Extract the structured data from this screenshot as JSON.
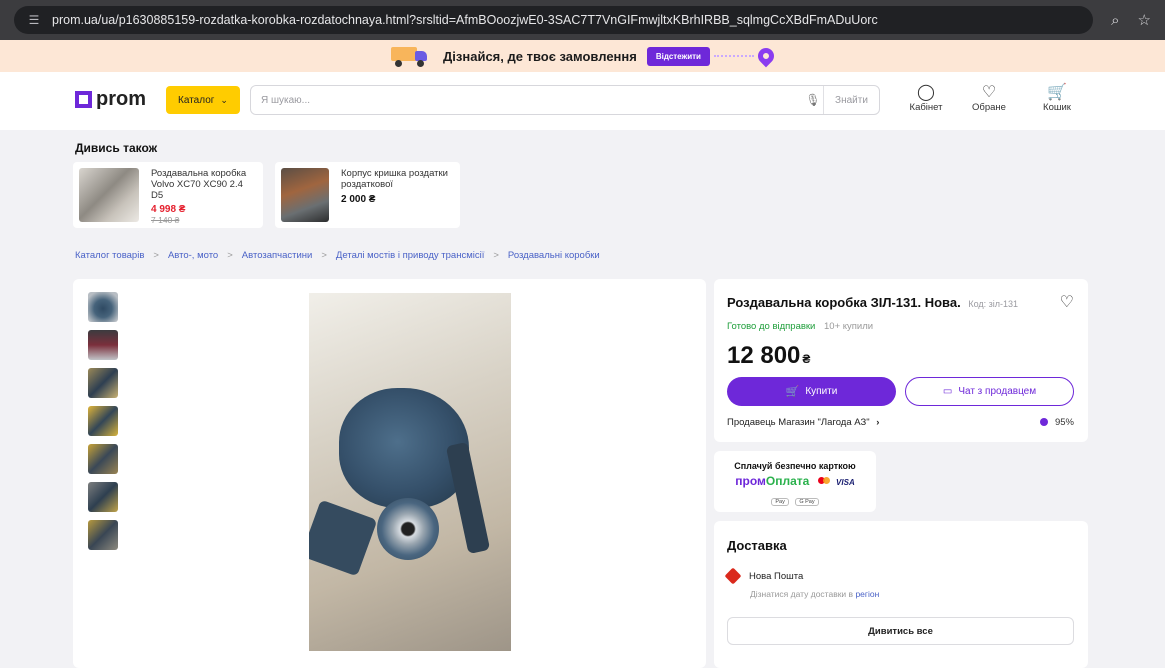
{
  "browser": {
    "url": "prom.ua/ua/p1630885159-rozdatka-korobka-rozdatochnaya.html?srsltid=AfmBOoozjwE0-3SAC7T7VnGIFmwjltxKBrhIRBB_sqlmgCcXBdFmADuUorc",
    "site_info_icon": "tune-icon",
    "zoom_icon": "zoom-icon",
    "bookmark_icon": "star-icon"
  },
  "promo": {
    "text": "Дізнайся, де твоє замовлення",
    "button": "Відстежити"
  },
  "header": {
    "logo": "prom",
    "catalog": "Каталог",
    "search_placeholder": "Я шукаю...",
    "search_button": "Знайти",
    "cabinet": "Кабінет",
    "favorites": "Обране",
    "cart": "Кошик"
  },
  "see_also": {
    "title": "Дивись також",
    "items": [
      {
        "name": "Роздавальна коробка Volvo XC70 XC90 2.4 D5",
        "price": "4 998 ₴",
        "old_price": "7 140 ₴"
      },
      {
        "name": "Корпус кришка роздатки роздаткової",
        "price": "2 000 ₴"
      }
    ]
  },
  "breadcrumbs": [
    "Каталог товарів",
    "Авто-, мото",
    "Автозапчастини",
    "Деталі мостів і приводу трансмісії",
    "Роздавальні коробки"
  ],
  "product": {
    "title": "Роздавальна коробка ЗІЛ-131. Нова.",
    "code": "Код: зіл-131",
    "status": "Готово до відправки",
    "bought": "10+ купили",
    "price": "12 800",
    "currency": "₴",
    "buy_button": "Купити",
    "chat_button": "Чат з продавцем",
    "seller": "Продавець Магазин \"Лагода АЗ\"",
    "rating": "95%"
  },
  "payment": {
    "title": "Сплачуй безпечно карткою",
    "brand_prom": "пром",
    "brand_oplata": "Оплата",
    "visa": "VISA",
    "wallets": [
      "Pay",
      "G Pay"
    ]
  },
  "delivery": {
    "title": "Доставка",
    "carrier": "Нова Пошта",
    "note_prefix": "Дізнатися дату доставки в",
    "note_link": "регіон",
    "see_all": "Дивитись все"
  },
  "colors": {
    "accent": "#6e28d9",
    "catalog_yellow": "#ffcc00",
    "sale_red": "#e5202e",
    "status_green": "#1e9e3a"
  }
}
